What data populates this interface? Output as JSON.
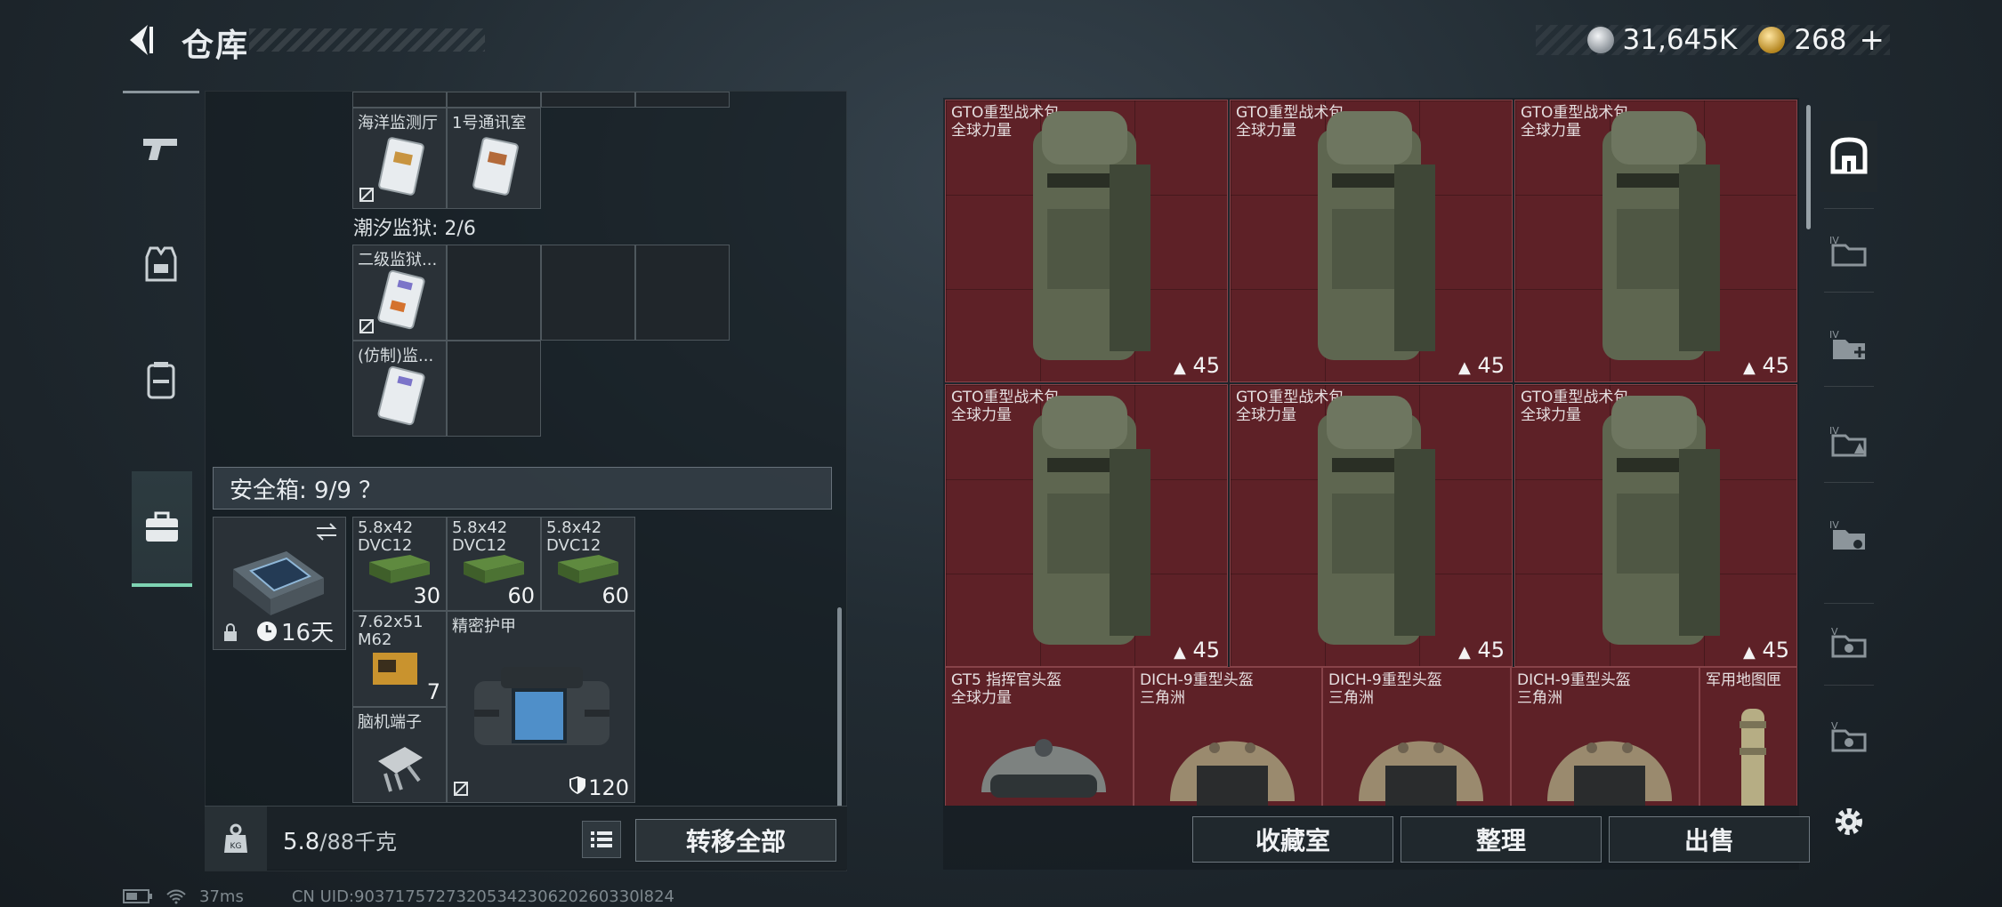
{
  "header": {
    "title": "仓库",
    "currency": [
      {
        "icon": "silver-coin-icon",
        "value": "31,645K"
      },
      {
        "icon": "gold-coin-icon",
        "value": "268"
      }
    ],
    "add_label": "+"
  },
  "left_nav": [
    {
      "icon": "weapon-icon",
      "active": false
    },
    {
      "icon": "armor-vest-icon",
      "active": false
    },
    {
      "icon": "backpack-icon",
      "active": false
    },
    {
      "icon": "briefcase-icon",
      "active": true
    }
  ],
  "stash": {
    "top_items": [
      {
        "name": "海洋监测厅"
      },
      {
        "name": "1号通讯室"
      }
    ],
    "group_label": "潮汐监狱: 2/6",
    "group_items": [
      {
        "name": "二级监狱..."
      },
      {
        "name": "(仿制)监..."
      }
    ],
    "safe_box_label": "安全箱: 9/9 ？",
    "safe_box": {
      "timer": "16天"
    },
    "ammo": [
      {
        "name": "5.8x42\nDVC12",
        "count": "30"
      },
      {
        "name": "5.8x42\nDVC12",
        "count": "60"
      },
      {
        "name": "5.8x42\nDVC12",
        "count": "60"
      },
      {
        "name": "7.62x51\nM62",
        "count": "7"
      }
    ],
    "armor_item": {
      "name": "精密护甲",
      "durability": "120"
    },
    "brain_item": {
      "name": "脑机端子"
    },
    "footer": {
      "weight": "5.8",
      "weight_cap": "/88千克",
      "transfer_label": "转移全部"
    }
  },
  "container": {
    "backpacks": [
      {
        "name": "GTO重型战术包",
        "sub": "全球力量",
        "count": "45"
      },
      {
        "name": "GTO重型战术包",
        "sub": "全球力量",
        "count": "45"
      },
      {
        "name": "GTO重型战术包",
        "sub": "全球力量",
        "count": "45"
      },
      {
        "name": "GTO重型战术包",
        "sub": "全球力量",
        "count": "45"
      },
      {
        "name": "GTO重型战术包",
        "sub": "全球力量",
        "count": "45"
      },
      {
        "name": "GTO重型战术包",
        "sub": "全球力量",
        "count": "45"
      }
    ],
    "helmets": [
      {
        "name": "GT5 指挥官头盔",
        "sub": "全球力量"
      },
      {
        "name": "DICH-9重型头盔",
        "sub": "三角洲"
      },
      {
        "name": "DICH-9重型头盔",
        "sub": "三角洲"
      },
      {
        "name": "DICH-9重型头盔",
        "sub": "三角洲"
      },
      {
        "name": "军用地图匣",
        "sub": ""
      }
    ],
    "buttons": {
      "collection": "收藏室",
      "sort": "整理",
      "sell": "出售"
    }
  },
  "side_icons": [
    "storage-icon",
    "folder-iv-icon",
    "folder-add-iv-icon",
    "folder-warning-iv-icon",
    "folder-iv-2-icon",
    "folder-v-icon",
    "folder-v-2-icon",
    "settings-icon"
  ],
  "status": {
    "ping": "37ms",
    "uid": "CN UID:9037175727320534230620260330l824"
  },
  "colors": {
    "accent": "#7ed3b2",
    "container_cell": "#5e2127"
  }
}
